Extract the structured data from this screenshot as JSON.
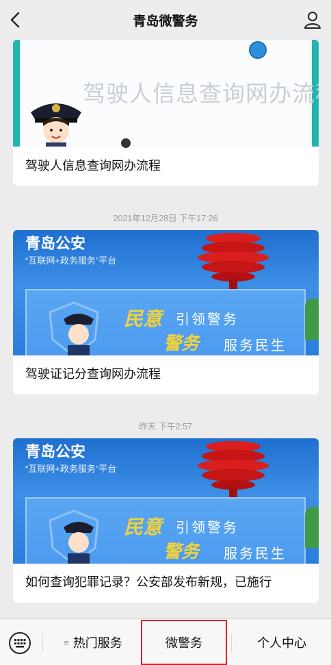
{
  "header": {
    "title": "青岛微警务",
    "back_icon": "chevron-left-icon",
    "user_icon": "user-icon"
  },
  "feed": {
    "cards": [
      {
        "banner_text": "驾驶人信息查询网办流程",
        "caption": "驾驶人信息查询网办流程"
      },
      {
        "timestamp": "2021年12月28日 下午17:26",
        "banner_title": "青岛公安",
        "banner_subtitle": "“互联网+政务服务”平台",
        "banner_line1_a": "民意",
        "banner_line1_b": "引领警务",
        "banner_line2_a": "警务",
        "banner_line2_b": "服务民生",
        "caption": "驾驶证记分查询网办流程"
      },
      {
        "timestamp": "昨天 下午2:57",
        "banner_title": "青岛公安",
        "banner_subtitle": "“互联网+政务服务”平台",
        "banner_line1_a": "民意",
        "banner_line1_b": "引领警务",
        "banner_line2_a": "警务",
        "banner_line2_b": "服务民生",
        "caption": "如何查询犯罪记录？公安部发布新规，已施行"
      }
    ]
  },
  "bottom_nav": {
    "keyboard_icon": "keyboard-icon",
    "items": [
      {
        "label": "热门服务",
        "icon": "menu-lines-icon"
      },
      {
        "label": "微警务"
      },
      {
        "label": "个人中心"
      }
    ],
    "highlight_color": "#e0202a"
  },
  "colors": {
    "teal_bar": "#21b5b0",
    "banner_blue": "#2a7fdc",
    "slogan_yellow": "#f3d23a"
  }
}
